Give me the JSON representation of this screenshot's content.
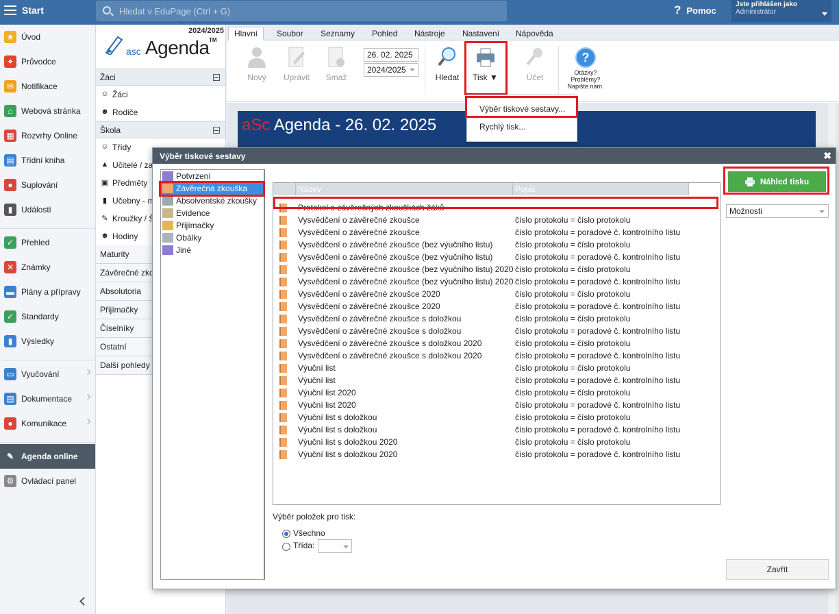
{
  "topbar": {
    "start_label": "Start",
    "search_placeholder": "Hledat v EduPage (Ctrl + G)",
    "help_icon": "?",
    "help_label": "Pomoc",
    "user_line1": "Jste přihlášen jako",
    "user_line2": "Administrátor"
  },
  "leftnav": {
    "items": [
      {
        "label": "Úvod",
        "icon": "★",
        "color": "#f2b01e"
      },
      {
        "label": "Průvodce",
        "icon": "✦",
        "color": "#e0452a"
      },
      {
        "label": "Notifikace",
        "icon": "✉",
        "color": "#f2a11e"
      },
      {
        "label": "Webová stránka",
        "icon": "⌂",
        "color": "#3aa05a"
      },
      {
        "label": "Rozvrhy Online",
        "icon": "▦",
        "color": "#d9463a"
      },
      {
        "label": "Třídní kniha",
        "icon": "▤",
        "color": "#3a82d0"
      },
      {
        "label": "Suplování",
        "icon": "●",
        "color": "#d9463a"
      },
      {
        "label": "Události",
        "icon": "▮",
        "color": "#555555"
      },
      {
        "label": "Přehled",
        "icon": "✓",
        "color": "#3aa05a"
      },
      {
        "label": "Známky",
        "icon": "✕",
        "color": "#d9463a"
      },
      {
        "label": "Plány a přípravy",
        "icon": "▬",
        "color": "#3a82d0"
      },
      {
        "label": "Standardy",
        "icon": "✓",
        "color": "#3aa05a"
      },
      {
        "label": "Výsledky",
        "icon": "▮",
        "color": "#3a82d0"
      },
      {
        "label": "Vyučování",
        "icon": "▭",
        "color": "#3a82d0"
      },
      {
        "label": "Dokumentace",
        "icon": "▤",
        "color": "#3a82d0"
      },
      {
        "label": "Komunikace",
        "icon": "●",
        "color": "#d9463a"
      },
      {
        "label": "Agenda online",
        "icon": "✎",
        "color": "#4d5a66"
      },
      {
        "label": "Ovládací panel",
        "icon": "⚙",
        "color": "#888888"
      }
    ]
  },
  "panel2": {
    "year": "2024/2025",
    "logo_asc": "asc",
    "logo_agenda": "Agenda",
    "logo_tm": "TM",
    "sections": {
      "zaci_header": "Žáci",
      "zaci_items": [
        "Žáci",
        "Rodiče"
      ],
      "skola_header": "Škola",
      "skola_items": [
        "Třídy",
        "Učitelé / za",
        "Předměty",
        "Učebny - m",
        "Kroužky / Š",
        "Hodiny"
      ],
      "plain": [
        "Maturity",
        "Závěrečné zko",
        "Absolutoria",
        "Přijímačky",
        "Číselníky",
        "Ostatní",
        "Další pohledy"
      ]
    }
  },
  "tabs": [
    "Hlavní",
    "Soubor",
    "Seznamy",
    "Pohled",
    "Nástroje",
    "Nastavení",
    "Nápověda"
  ],
  "ribbon": {
    "new": "Nový",
    "edit": "Upravit",
    "delete": "Smaž",
    "date": "26. 02. 2025",
    "year": "2024/2025",
    "search": "Hledat",
    "print": "Tisk",
    "account": "Účet",
    "questions": "Otázky?",
    "problems": "Problémy?",
    "write_us": "Napište nám."
  },
  "print_menu": {
    "choose_report": "Výběr tiskové sestavy...",
    "quick_print": "Rychlý tisk..."
  },
  "doc_banner": {
    "asc": "aSc",
    "title": " Agenda - 26. 02. 2025"
  },
  "dialog": {
    "title": "Výběr tiskové sestavy",
    "close": "✖",
    "categories": [
      "Potvrzení",
      "Závěrečná zkouška",
      "Absolventské zkoušky",
      "Evidence",
      "Přijímačky",
      "Obálky",
      "Jiné"
    ],
    "col_name": "Název",
    "col_desc": "Popis",
    "rows": [
      {
        "name": "Protokol o závěrečných zkouškách žáků",
        "desc": ""
      },
      {
        "name": "Vysvědčení o závěrečné zkoušce",
        "desc": "číslo protokolu = číslo protokolu"
      },
      {
        "name": "Vysvědčení o závěrečné zkoušce",
        "desc": "číslo protokolu = poradové č. kontrolního listu"
      },
      {
        "name": "Vysvědčení o závěrečné zkoušce (bez výučního listu)",
        "desc": "číslo protokolu = číslo protokolu"
      },
      {
        "name": "Vysvědčení o závěrečné zkoušce (bez výučního listu)",
        "desc": "číslo protokolu = poradové č. kontrolního listu"
      },
      {
        "name": "Vysvědčení o závěrečné zkoušce (bez výučního listu) 2020",
        "desc": "číslo protokolu = číslo protokolu"
      },
      {
        "name": "Vysvědčení o závěrečné zkoušce (bez výučního listu) 2020",
        "desc": "číslo protokolu = poradové č. kontrolního listu"
      },
      {
        "name": "Vysvědčení o závěrečné zkoušce 2020",
        "desc": "číslo protokolu = číslo protokolu"
      },
      {
        "name": "Vysvědčení o závěrečné zkoušce 2020",
        "desc": "číslo protokolu = poradové č. kontrolního listu"
      },
      {
        "name": "Vysvědčení o závěrečné zkoušce s doložkou",
        "desc": "číslo protokolu = číslo protokolu"
      },
      {
        "name": "Vysvědčení o závěrečné zkoušce s doložkou",
        "desc": "číslo protokolu = poradové č. kontrolního listu"
      },
      {
        "name": "Vysvědčení o závěrečné zkoušce s doložkou 2020",
        "desc": "číslo protokolu = číslo protokolu"
      },
      {
        "name": "Vysvědčení o závěrečné zkoušce s doložkou 2020",
        "desc": "číslo protokolu = poradové č. kontrolního listu"
      },
      {
        "name": "Výuční list",
        "desc": "číslo protokolu = číslo protokolu"
      },
      {
        "name": "Výuční list",
        "desc": "číslo protokolu = poradové č. kontrolního listu"
      },
      {
        "name": "Výuční list 2020",
        "desc": "číslo protokolu = číslo protokolu"
      },
      {
        "name": "Výuční list 2020",
        "desc": "číslo protokolu = poradové č. kontrolního listu"
      },
      {
        "name": "Výuční list s doložkou",
        "desc": "číslo protokolu = číslo protokolu"
      },
      {
        "name": "Výuční list s doložkou",
        "desc": "číslo protokolu = poradové č. kontrolního listu"
      },
      {
        "name": "Výuční list s doložkou 2020",
        "desc": "číslo protokolu = číslo protokolu"
      },
      {
        "name": "Výuční list s doložkou 2020",
        "desc": "číslo protokolu = poradové č. kontrolního listu"
      }
    ],
    "preview_button": "Náhled tisku",
    "options_select": "Možnosti",
    "selection_label": "Výběr položek pro tisk:",
    "radio_all": "Všechno",
    "radio_class": "Třída:",
    "close_button": "Zavřít"
  }
}
